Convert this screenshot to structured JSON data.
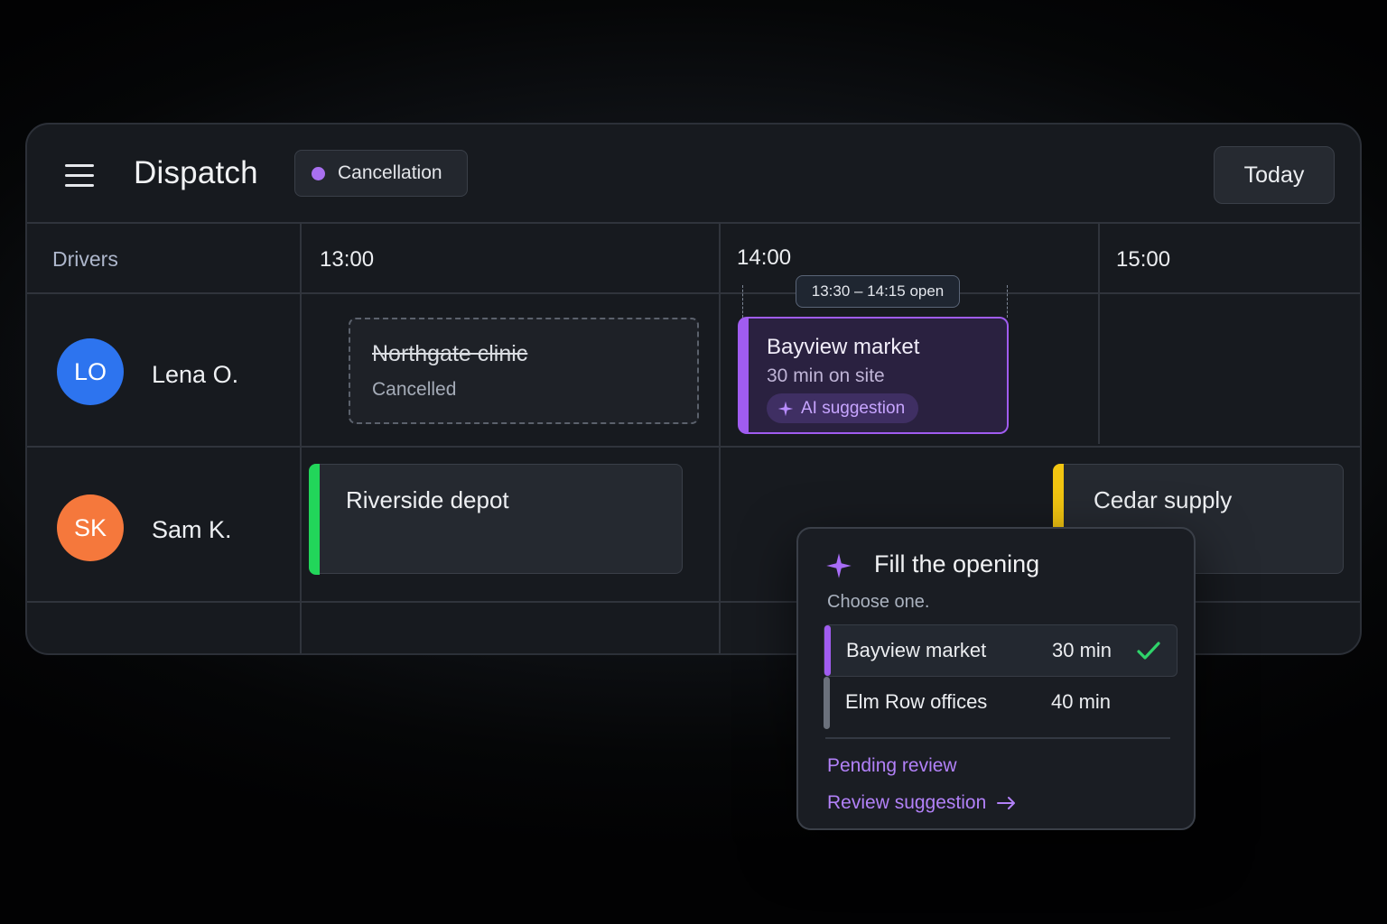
{
  "header": {
    "title": "Dispatch",
    "filter_chip": {
      "label": "Cancellation",
      "dot_color": "#a970f0"
    },
    "today_label": "Today"
  },
  "timeline": {
    "drivers_label": "Drivers",
    "hours": [
      "13:00",
      "14:00",
      "15:00"
    ]
  },
  "drivers": [
    {
      "initials": "LO",
      "name": "Lena O.",
      "avatar_color": "#2d74ef"
    },
    {
      "initials": "SK",
      "name": "Sam K.",
      "avatar_color": "#f5783c"
    }
  ],
  "jobs": {
    "cancelled": {
      "title": "Northgate clinic",
      "status": "Cancelled"
    },
    "suggested": {
      "title": "Bayview market",
      "detail": "30 min on site",
      "badge": "AI suggestion",
      "accent_color": "#a05cf0"
    },
    "gap_tooltip": "13:30 – 14:15 open",
    "riverside": {
      "title": "Riverside depot",
      "accent_color": "#22d65a"
    },
    "cedar": {
      "title": "Cedar supply",
      "accent_color": "#f2c511"
    }
  },
  "popover": {
    "title": "Fill the opening",
    "subtitle": "Choose one.",
    "options": [
      {
        "name": "Bayview market",
        "duration": "30 min",
        "selected": true,
        "bar_color": "#a05cf0"
      },
      {
        "name": "Elm Row offices",
        "duration": "40 min",
        "selected": false,
        "bar_color": "#6b717c"
      }
    ],
    "status": "Pending review",
    "action": "Review suggestion"
  }
}
